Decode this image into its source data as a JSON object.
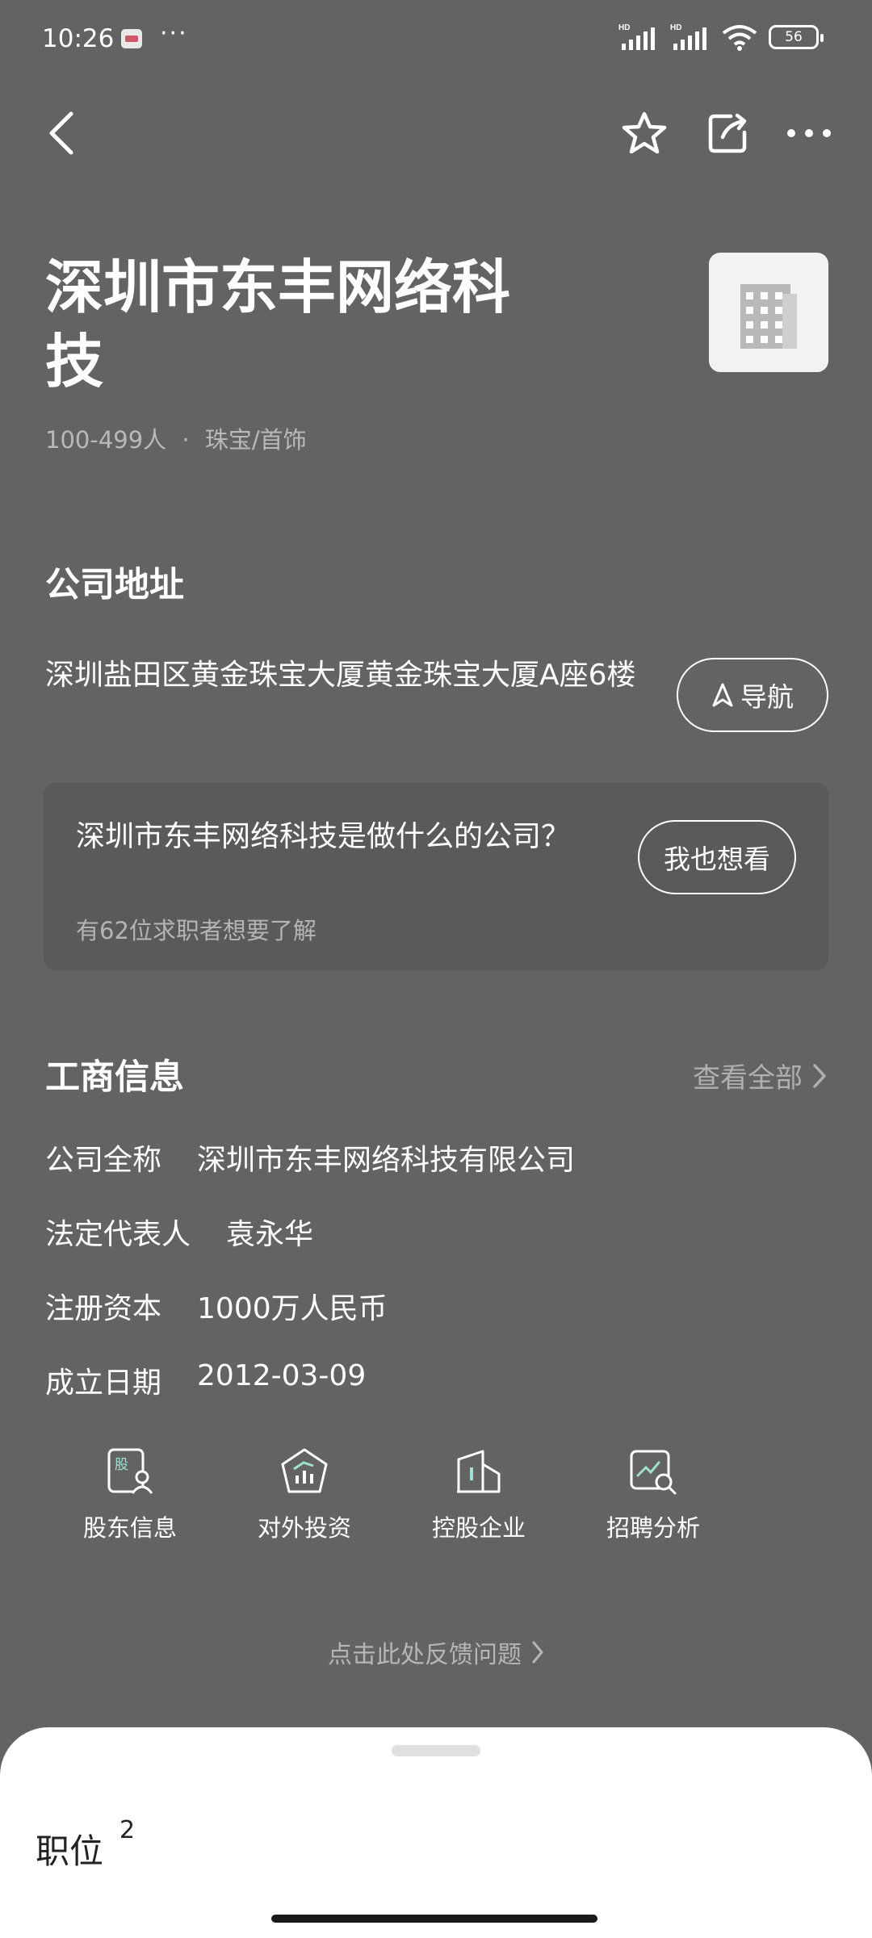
{
  "status_bar": {
    "time": "10:26",
    "more": "···",
    "network_1": "HD",
    "network_2": "HD",
    "battery": "56"
  },
  "top_bar": {
    "icons": [
      "back-icon",
      "star-icon",
      "share-icon",
      "more-icon"
    ]
  },
  "company": {
    "name": "深圳市东丰网络科技",
    "size": "100-499人",
    "separator": "·",
    "industry": "珠宝/首饰"
  },
  "address_section": {
    "title": "公司地址",
    "address": "深圳盐田区黄金珠宝大厦黄金珠宝大厦A座6楼",
    "nav_label": "导航"
  },
  "qa_card": {
    "question": "深圳市东丰网络科技是做什么的公司？",
    "sub": "有62位求职者想要了解",
    "button": "我也想看"
  },
  "business_info": {
    "title": "工商信息",
    "view_all": "查看全部",
    "rows": [
      {
        "label": "公司全称",
        "value": "深圳市东丰网络科技有限公司"
      },
      {
        "label": "法定代表人",
        "value": "袁永华"
      },
      {
        "label": "注册资本",
        "value": "1000万人民币"
      },
      {
        "label": "成立日期",
        "value": "2012-03-09"
      }
    ]
  },
  "quick_links": [
    {
      "label": "股东信息",
      "icon": "shareholder-icon"
    },
    {
      "label": "对外投资",
      "icon": "investment-icon"
    },
    {
      "label": "控股企业",
      "icon": "holding-company-icon"
    },
    {
      "label": "招聘分析",
      "icon": "recruitment-analysis-icon"
    }
  ],
  "feedback": {
    "label": "点击此处反馈问题"
  },
  "bottom_sheet": {
    "title": "职位",
    "count": "2"
  },
  "colors": {
    "background": "#636363",
    "card": "#5a5a5a",
    "sheet": "#ffffff"
  }
}
